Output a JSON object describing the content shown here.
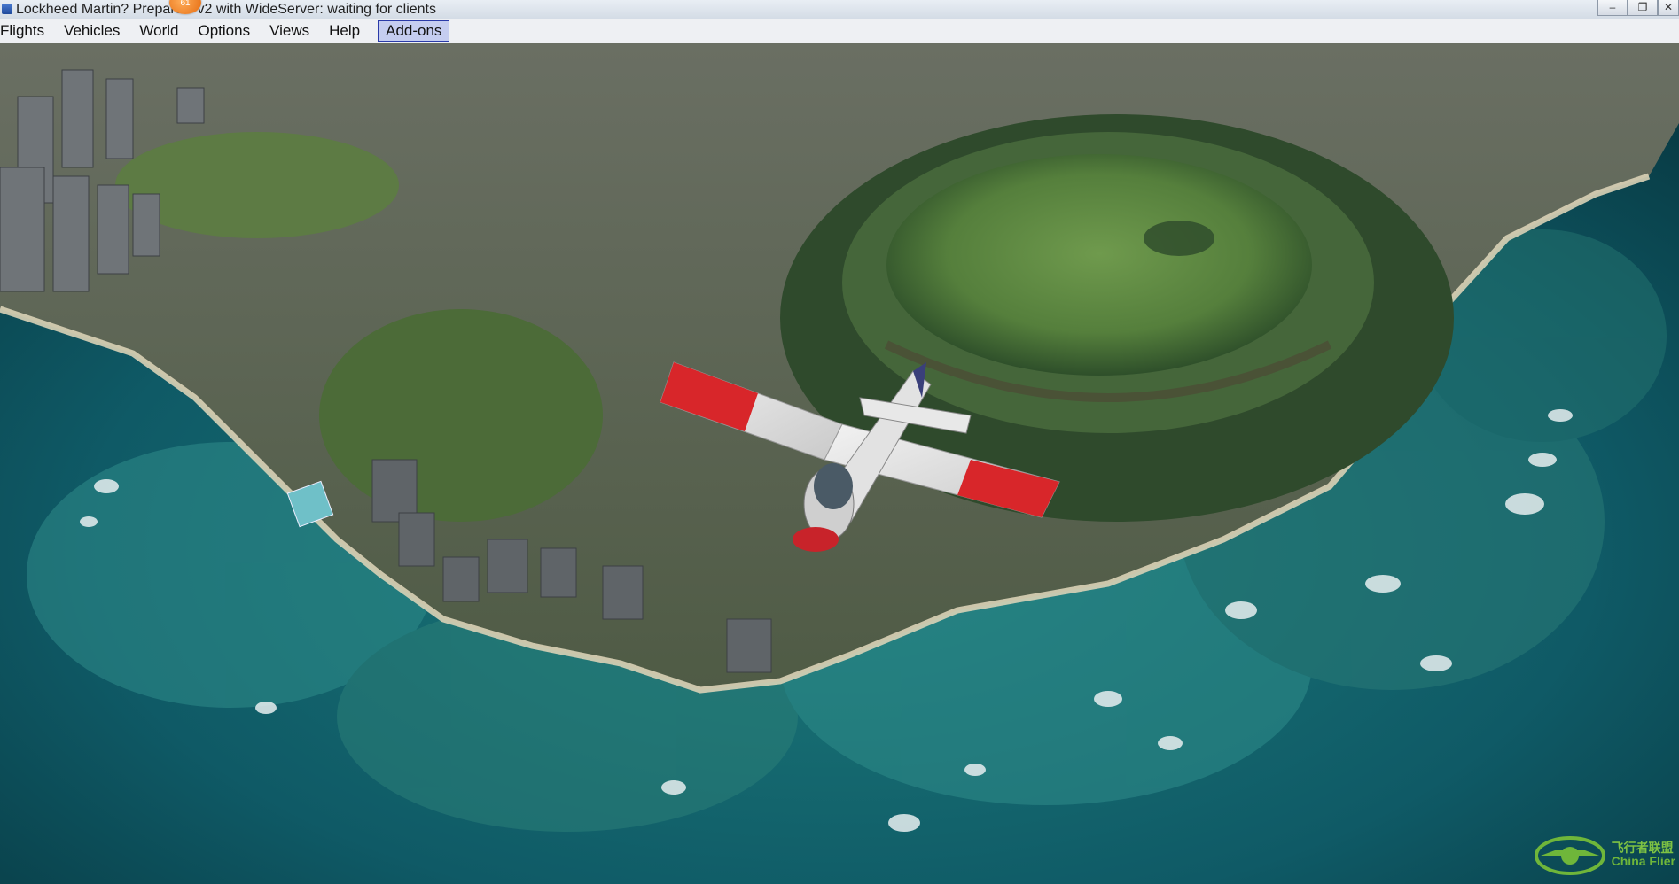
{
  "window": {
    "title": "Lockheed Martin? Prepar3D v2 with WideServer: waiting for clients",
    "notification_count": "61",
    "controls": {
      "minimize": "–",
      "restore": "❐",
      "close": "✕"
    }
  },
  "menu": {
    "items": [
      {
        "label": "Flights"
      },
      {
        "label": "Vehicles"
      },
      {
        "label": "World"
      },
      {
        "label": "Options"
      },
      {
        "label": "Views"
      },
      {
        "label": "Help"
      },
      {
        "label": "Add-ons"
      }
    ],
    "active_index": 6
  },
  "scene": {
    "icons": [
      "aircraft-icon",
      "diamond-head-crater",
      "city-buildings",
      "ocean-reef"
    ],
    "colors": {
      "ocean": "#0f5a66",
      "reef": "#2f8d8a",
      "land": "#5b6d4f",
      "crater": "#3f6b3a",
      "wing_tip": "#d8262a"
    }
  },
  "watermark": {
    "line1": "飞行者联盟",
    "line2": "China Flier"
  }
}
